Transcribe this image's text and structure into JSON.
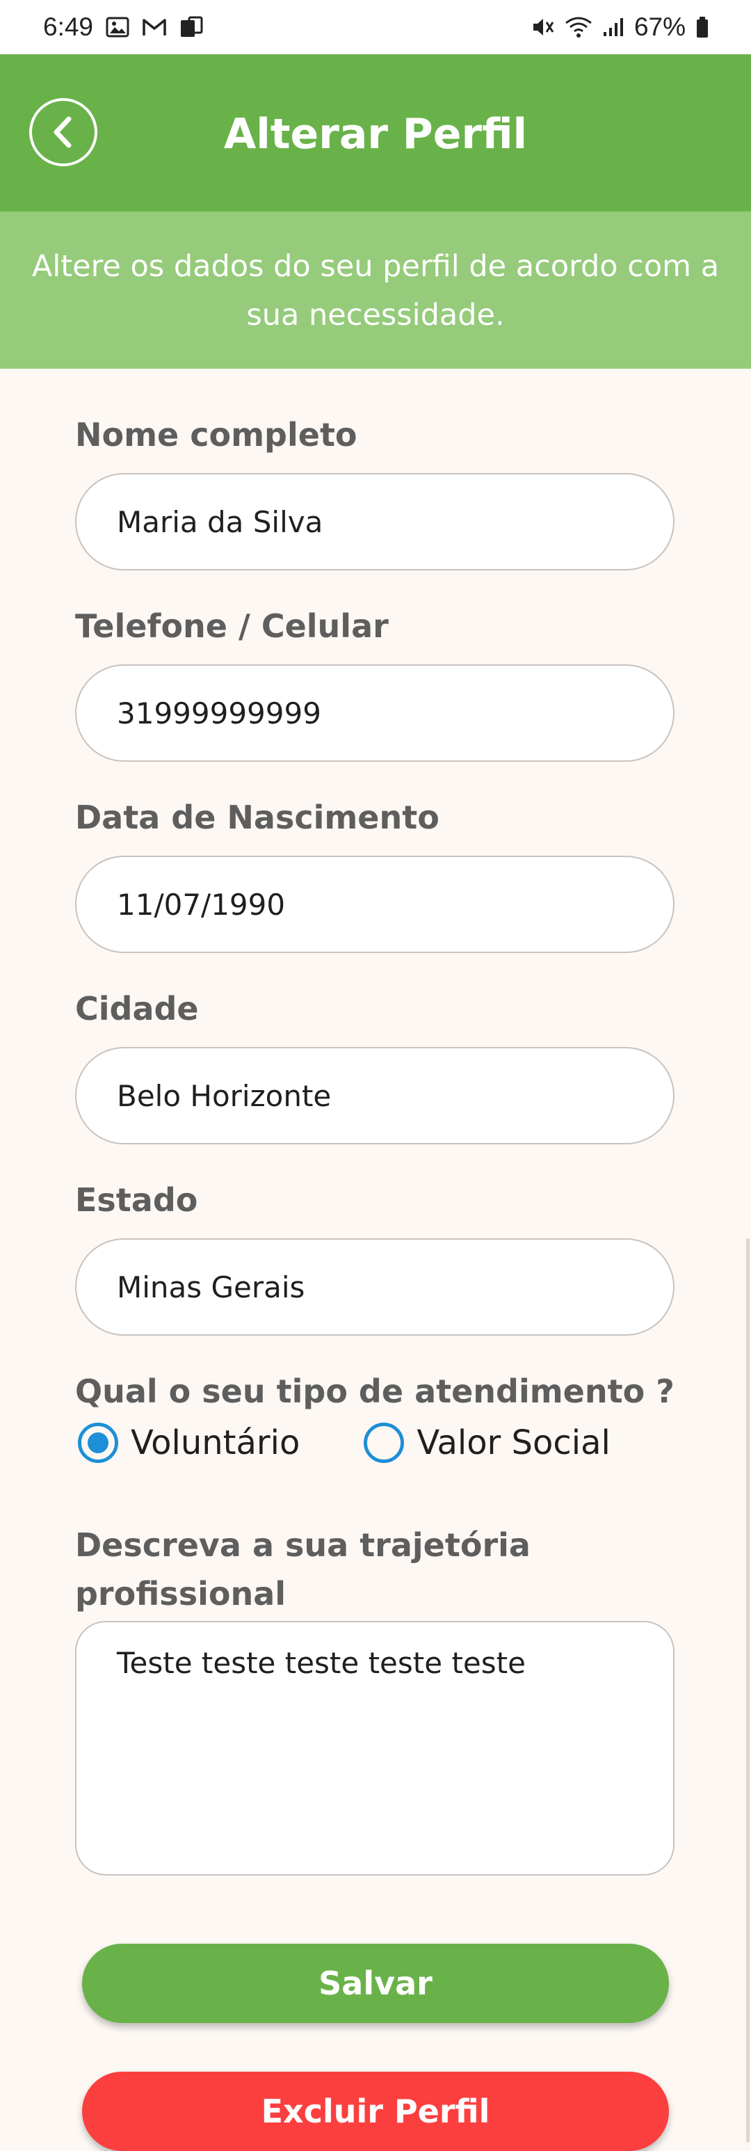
{
  "status_bar": {
    "time": "6:49",
    "battery": "67%",
    "left_icons": [
      "image-icon",
      "gmail-icon",
      "device-icon"
    ],
    "right_icons": [
      "mute-icon",
      "wifi-icon",
      "signal-icon",
      "battery-icon"
    ]
  },
  "header": {
    "title": "Alterar Perfil",
    "back_icon": "chevron-left-icon"
  },
  "banner": {
    "text": "Altere os dados do seu perfil de acordo com a sua necessidade."
  },
  "form": {
    "fields": [
      {
        "label": "Nome completo",
        "value": "Maria da Silva"
      },
      {
        "label": "Telefone / Celular",
        "value": "31999999999"
      },
      {
        "label": "Data de Nascimento",
        "value": "11/07/1990"
      },
      {
        "label": "Cidade",
        "value": "Belo Horizonte"
      },
      {
        "label": "Estado",
        "value": "Minas Gerais"
      }
    ],
    "service_type": {
      "label": "Qual o seu tipo de atendimento ?",
      "options": [
        "Voluntário",
        "Valor Social"
      ],
      "selected": "Voluntário"
    },
    "trajectory": {
      "label": "Descreva a sua trajetória profissional",
      "value": "Teste teste teste teste teste"
    }
  },
  "buttons": {
    "save": "Salvar",
    "delete": "Excluir Perfil"
  },
  "colors": {
    "header": "#69B24A",
    "banner": "#95CB7B",
    "background": "#FDF8F4",
    "radio": "#1E8FD6",
    "save": "#69B24A",
    "delete": "#FB3F3F"
  }
}
